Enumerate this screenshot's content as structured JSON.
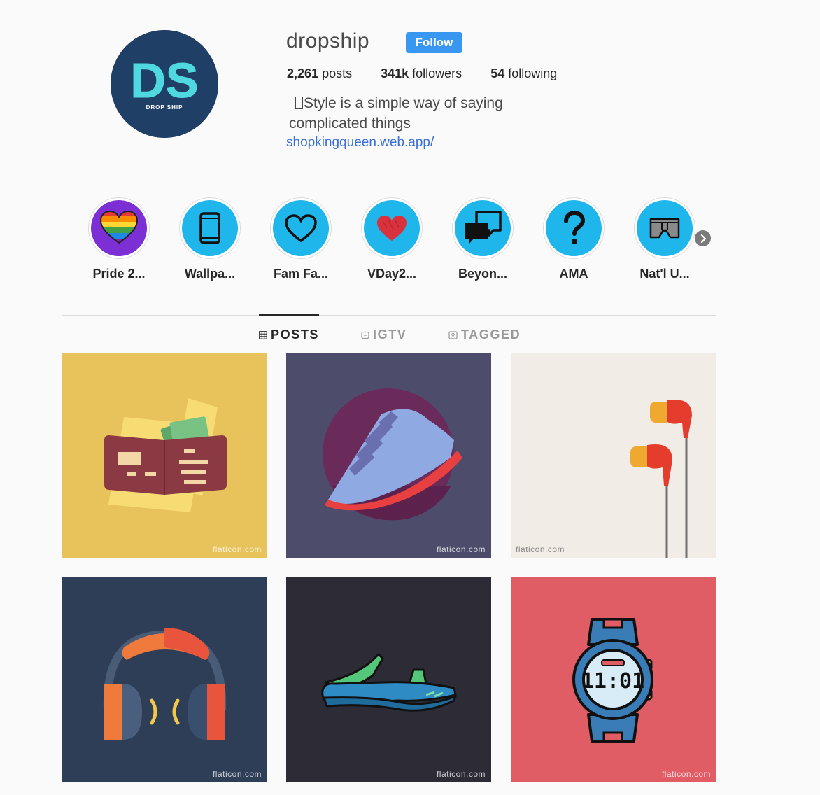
{
  "profile": {
    "username": "dropship",
    "follow_label": "Follow",
    "posts_count": "2,261",
    "posts_label": "posts",
    "followers_count": "341k",
    "followers_label": "followers",
    "following_count": "54",
    "following_label": "following",
    "bio_line1": "Style is a simple way of saying",
    "bio_line2": "complicated things",
    "link": "shopkingqueen.web.app/",
    "avatar_text": "DS",
    "avatar_subtext": "DROP SHIP"
  },
  "highlights": [
    {
      "label": "Pride 2...",
      "icon": "rainbow-heart-icon"
    },
    {
      "label": "Wallpa...",
      "icon": "phone-icon"
    },
    {
      "label": "Fam Fa...",
      "icon": "heart-outline-icon"
    },
    {
      "label": "VDay2...",
      "icon": "red-heart-icon"
    },
    {
      "label": "Beyon...",
      "icon": "speech-bubbles-icon"
    },
    {
      "label": "AMA",
      "icon": "question-mark-icon"
    },
    {
      "label": "Nat'l U...",
      "icon": "underwear-icon"
    }
  ],
  "tabs": [
    {
      "label": "POSTS",
      "icon": "grid-icon",
      "active": true
    },
    {
      "label": "IGTV",
      "icon": "tv-icon",
      "active": false
    },
    {
      "label": "TAGGED",
      "icon": "tag-icon",
      "active": false
    }
  ],
  "posts": [
    {
      "subject": "wallet-illustration",
      "bg": "#e8c25a",
      "watermark": "flaticon.com"
    },
    {
      "subject": "sneaker-illustration",
      "bg": "#4d4d6b",
      "watermark": "flaticon.com"
    },
    {
      "subject": "earphones-illustration",
      "bg": "#f1ece5",
      "watermark": "flaticon.com"
    },
    {
      "subject": "headphones-illustration",
      "bg": "#2d3e56",
      "watermark": "flaticon.com"
    },
    {
      "subject": "sandal-illustration",
      "bg": "#2c2b36",
      "watermark": "flaticon.com"
    },
    {
      "subject": "watch-illustration",
      "bg": "#e05d66",
      "watermark": "flaticon.com"
    }
  ],
  "colors": {
    "accent": "#3897f0",
    "link": "#3a6fd8",
    "highlight_disc": "#1fb6ec",
    "avatar_bg": "#1f3f66",
    "avatar_text": "#4fd8e0"
  }
}
